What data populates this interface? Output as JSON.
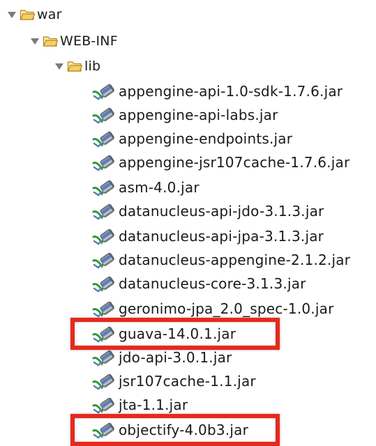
{
  "tree": {
    "root": {
      "label": "war",
      "expanded": true
    },
    "webinf": {
      "label": "WEB-INF",
      "expanded": true
    },
    "lib": {
      "label": "lib",
      "expanded": true
    },
    "jars": [
      {
        "label": "appengine-api-1.0-sdk-1.7.6.jar",
        "icon": "jar-icon",
        "highlighted": false
      },
      {
        "label": "appengine-api-labs.jar",
        "icon": "jar-icon",
        "highlighted": false
      },
      {
        "label": "appengine-endpoints.jar",
        "icon": "jar-icon",
        "highlighted": false
      },
      {
        "label": "appengine-jsr107cache-1.7.6.jar",
        "icon": "jar-icon",
        "highlighted": false
      },
      {
        "label": "asm-4.0.jar",
        "icon": "jar-icon",
        "highlighted": false
      },
      {
        "label": "datanucleus-api-jdo-3.1.3.jar",
        "icon": "jar-icon",
        "highlighted": false
      },
      {
        "label": "datanucleus-api-jpa-3.1.3.jar",
        "icon": "jar-icon",
        "highlighted": false
      },
      {
        "label": "datanucleus-appengine-2.1.2.jar",
        "icon": "jar-icon",
        "highlighted": false
      },
      {
        "label": "datanucleus-core-3.1.3.jar",
        "icon": "jar-icon",
        "highlighted": false
      },
      {
        "label": "geronimo-jpa_2.0_spec-1.0.jar",
        "icon": "jar-icon",
        "highlighted": false
      },
      {
        "label": "guava-14.0.1.jar",
        "icon": "jar-icon",
        "highlighted": true
      },
      {
        "label": "jdo-api-3.0.1.jar",
        "icon": "jar-icon",
        "highlighted": false
      },
      {
        "label": "jsr107cache-1.1.jar",
        "icon": "jar-icon",
        "highlighted": false
      },
      {
        "label": "jta-1.1.jar",
        "icon": "jar-icon",
        "highlighted": false
      },
      {
        "label": "objectify-4.0b3.jar",
        "icon": "jar-icon",
        "highlighted": true
      }
    ]
  },
  "colors": {
    "highlight": "#e8281c",
    "folder_fill": "#f3cf6c",
    "folder_stroke": "#b8861c",
    "triangle": "#7a7a7a",
    "jar_body": "#8a8f99",
    "jar_band": "#4a7fd0",
    "jar_arrow": "#2f9a3a"
  }
}
